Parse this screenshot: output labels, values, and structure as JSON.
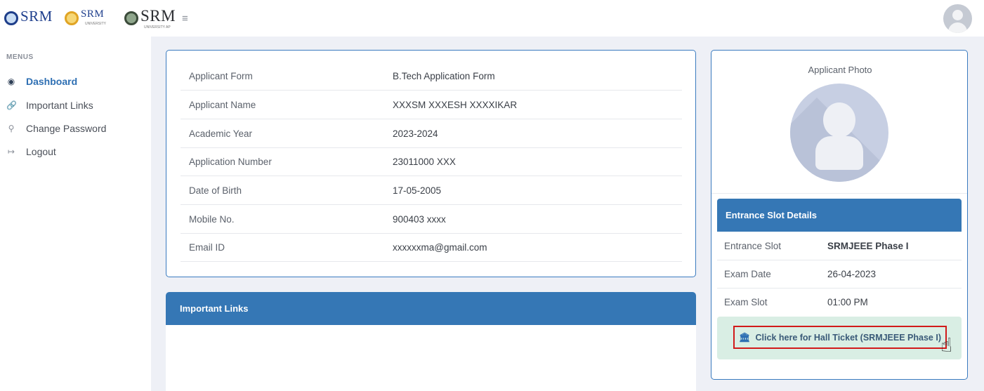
{
  "header": {
    "logos": [
      {
        "name": "srm-logo-1",
        "text": "SRM"
      },
      {
        "name": "srm-university-logo",
        "text": "SRM",
        "subtext": "UNIVERSITY"
      },
      {
        "name": "srm-university-ap-logo",
        "text": "SRM",
        "subtext": "UNIVERSITY AP"
      }
    ],
    "menu_icon": "hamburger-icon",
    "avatar_icon": "user-avatar-icon"
  },
  "sidebar": {
    "title": "MENUS",
    "items": [
      {
        "label": "Dashboard",
        "icon": "dashboard-icon",
        "active": true
      },
      {
        "label": "Important Links",
        "icon": "link-icon",
        "active": false
      },
      {
        "label": "Change Password",
        "icon": "key-icon",
        "active": false
      },
      {
        "label": "Logout",
        "icon": "logout-icon",
        "active": false
      }
    ]
  },
  "applicant": {
    "rows": [
      {
        "label": "Applicant Form",
        "value": "B.Tech Application Form"
      },
      {
        "label": "Applicant Name",
        "value": "XXXSM XXXESH XXXXIKAR"
      },
      {
        "label": "Academic Year",
        "value": "2023-2024"
      },
      {
        "label": "Application Number",
        "value": "23011000 XXX"
      },
      {
        "label": "Date of Birth",
        "value": "17-05-2005"
      },
      {
        "label": "Mobile No.",
        "value": "900403 xxxx"
      },
      {
        "label": "Email ID",
        "value": "xxxxxxma@gmail.com"
      }
    ]
  },
  "important_links": {
    "title": "Important Links"
  },
  "photo_card": {
    "title": "Applicant Photo"
  },
  "slot": {
    "title": "Entrance Slot Details",
    "rows": [
      {
        "label": "Entrance Slot",
        "value": "SRMJEEE Phase I"
      },
      {
        "label": "Exam Date",
        "value": "26-04-2023"
      },
      {
        "label": "Exam Slot",
        "value": "01:00 PM"
      }
    ],
    "hall_ticket_label": "Click here for Hall Ticket (SRMJEEE Phase I)"
  },
  "colors": {
    "accent": "#3577b5",
    "highlight_border": "#d11a1a",
    "hall_box_bg": "#d9eee4"
  }
}
